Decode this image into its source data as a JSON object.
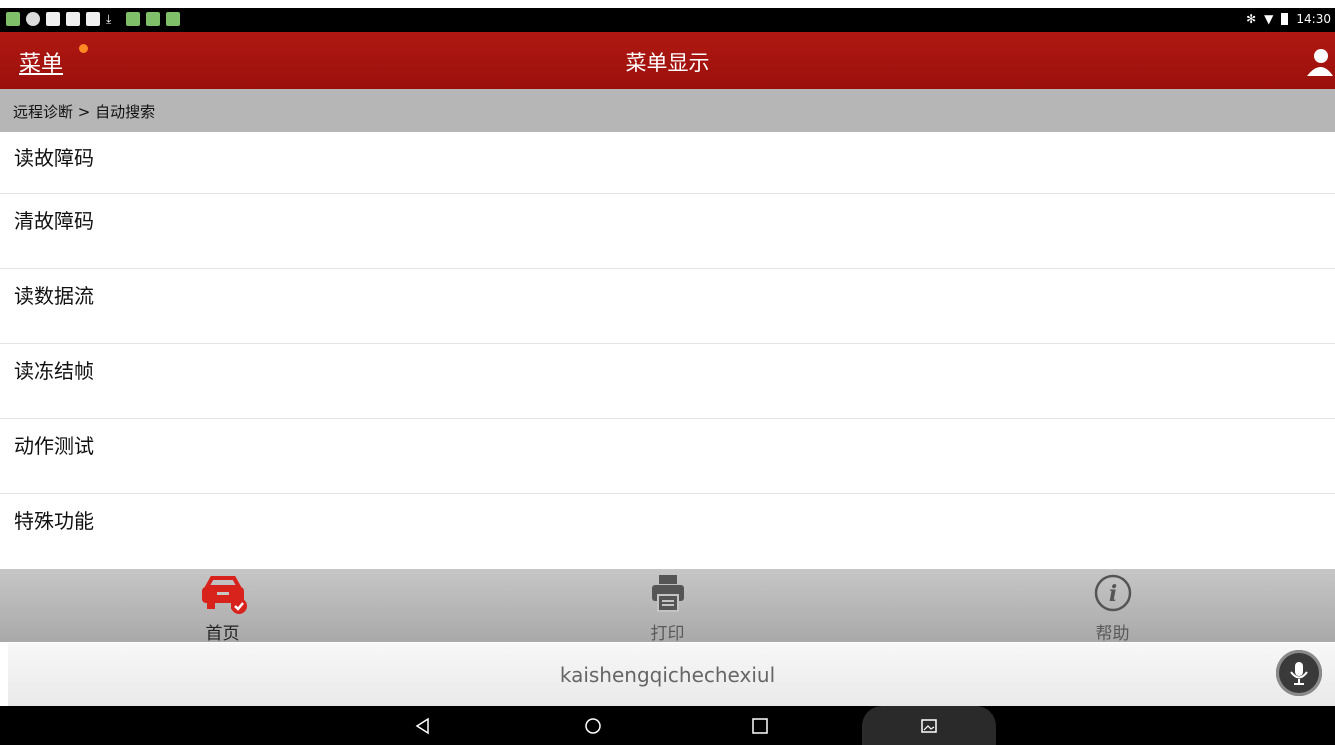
{
  "status_bar": {
    "time": "14:30",
    "icons": [
      "android-app-icon",
      "headset-icon",
      "image-icon",
      "square-icon",
      "square-icon",
      "download-icon",
      "app-icon",
      "android-app-icon",
      "app-icon"
    ],
    "right_icons": [
      "bluetooth-icon",
      "wifi-icon",
      "battery-icon"
    ]
  },
  "app_bar": {
    "menu_label": "菜单",
    "title": "菜单显示",
    "accent_color": "#b01812",
    "badge_color": "#ff8a24"
  },
  "breadcrumb": {
    "text": "远程诊断 > 自动搜索"
  },
  "menu_items": [
    {
      "label": "读故障码"
    },
    {
      "label": "清故障码"
    },
    {
      "label": "读数据流"
    },
    {
      "label": "读冻结帧"
    },
    {
      "label": "动作测试"
    },
    {
      "label": "特殊功能"
    }
  ],
  "bottom_tabs": [
    {
      "label": "首页",
      "icon": "car-icon",
      "active": true
    },
    {
      "label": "打印",
      "icon": "printer-icon",
      "active": false
    },
    {
      "label": "帮助",
      "icon": "info-icon",
      "active": false
    }
  ],
  "search_bar": {
    "text": "kaishengqichechexiul",
    "icon": "microphone-icon"
  },
  "nav_bar": {
    "icons": [
      "back-icon",
      "home-icon",
      "recents-icon",
      "screenshot-icon"
    ]
  }
}
